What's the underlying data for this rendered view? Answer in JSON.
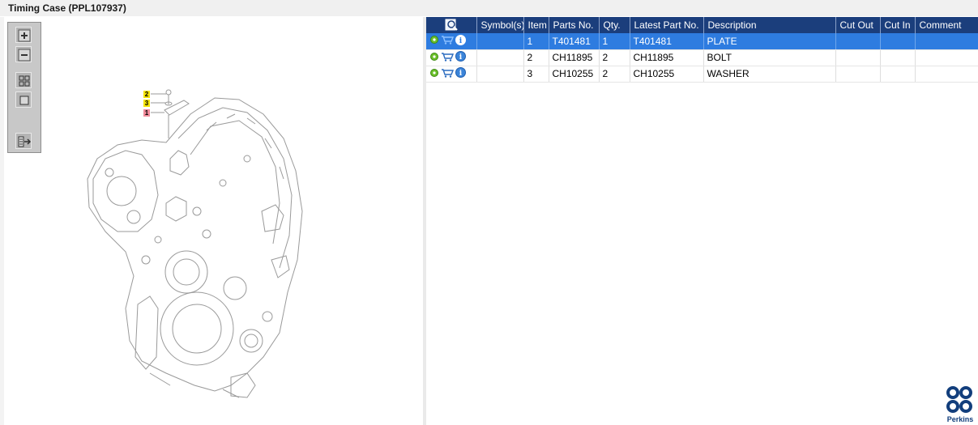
{
  "window": {
    "title": "Timing Case (PPL107937)"
  },
  "toolbar": {
    "buttons": [
      "zoom-in",
      "zoom-out",
      "fit-view",
      "actual-size",
      "export-view"
    ]
  },
  "diagram": {
    "callouts": [
      {
        "label": "2",
        "color": "#f5e400"
      },
      {
        "label": "3",
        "color": "#f5e400"
      },
      {
        "label": "1",
        "color": "#f08a9a"
      }
    ]
  },
  "table": {
    "columns": [
      "Symbol(s)",
      "Item",
      "Parts No.",
      "Qty.",
      "Latest Part No.",
      "Description",
      "Cut Out",
      "Cut In",
      "Comment"
    ],
    "rows": [
      {
        "item": "1",
        "parts_no": "T401481",
        "qty": "1",
        "latest_part_no": "T401481",
        "description": "PLATE",
        "selected": true
      },
      {
        "item": "2",
        "parts_no": "CH11895",
        "qty": "2",
        "latest_part_no": "CH11895",
        "description": "BOLT",
        "selected": false
      },
      {
        "item": "3",
        "parts_no": "CH10255",
        "qty": "2",
        "latest_part_no": "CH10255",
        "description": "WASHER",
        "selected": false
      }
    ]
  },
  "brand": {
    "name": "Perkins",
    "color": "#123e7c"
  },
  "colors": {
    "header": "#1b3e7c",
    "selected_row": "#2e7ce0"
  }
}
